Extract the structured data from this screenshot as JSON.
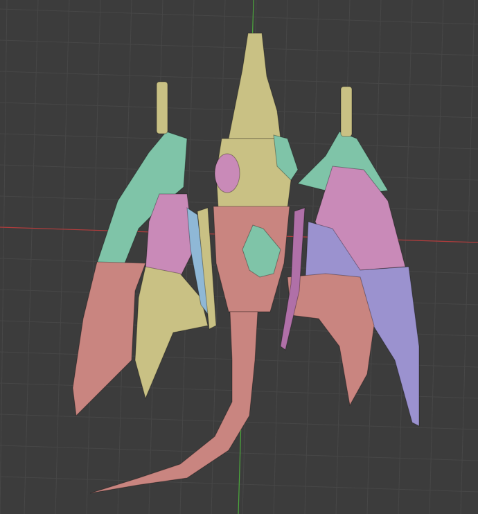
{
  "viewport": {
    "background_color": "#3c3c3c",
    "grid_color": "#474747",
    "x_axis_color": "#b43c3c",
    "y_axis_color": "#4caa3c"
  },
  "model": {
    "part_colors": {
      "teal": "#7fc4a8",
      "salmon": "#c98580",
      "pink": "#c98ab8",
      "yellow": "#c9c184",
      "lavender": "#9b92cf",
      "blue": "#8fb8d6",
      "magenta": "#b070a8"
    }
  }
}
